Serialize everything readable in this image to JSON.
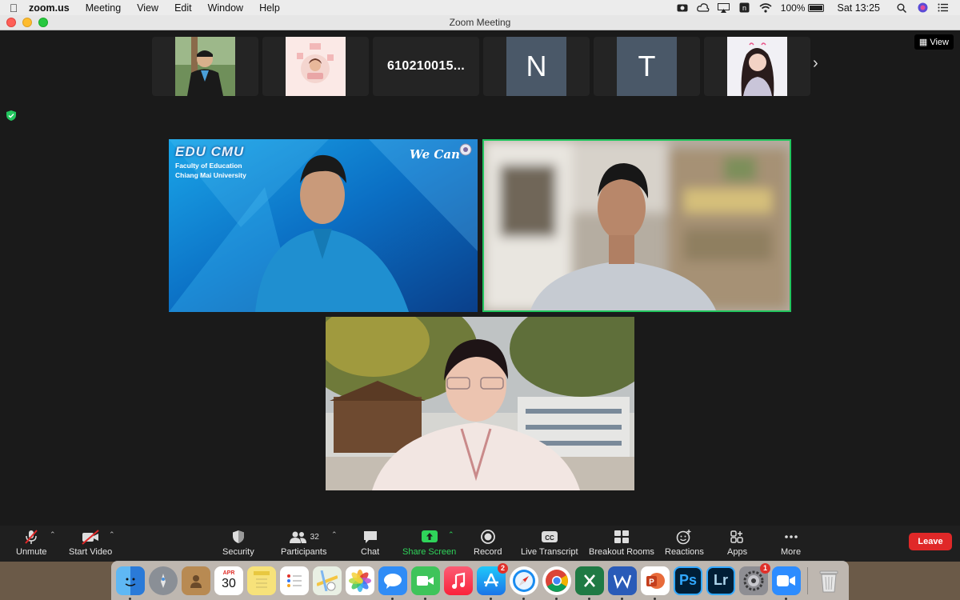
{
  "menubar": {
    "app_name": "zoom.us",
    "menus": [
      "Meeting",
      "View",
      "Edit",
      "Window",
      "Help"
    ],
    "battery": "100%",
    "clock": "Sat 13:25"
  },
  "window": {
    "title": "Zoom Meeting"
  },
  "strip": {
    "participant_name": "610210015...",
    "letter_n": "N",
    "letter_t": "T",
    "view_label": "View",
    "next_glyph": "›"
  },
  "tiles": {
    "logo_text": "EDU CMU",
    "faculty_line1": "Faculty of Education",
    "faculty_line2": "Chiang Mai University",
    "slogan": "We Can"
  },
  "toolbar": {
    "unmute": "Unmute",
    "start_video": "Start Video",
    "security": "Security",
    "participants": "Participants",
    "participants_count": "32",
    "chat": "Chat",
    "share_screen": "Share Screen",
    "record": "Record",
    "live_transcript": "Live Transcript",
    "breakout_rooms": "Breakout Rooms",
    "reactions": "Reactions",
    "apps": "Apps",
    "more": "More",
    "leave": "Leave"
  },
  "dock": {
    "calendar_month": "APR",
    "calendar_day": "30",
    "appstore_badge": "2",
    "settings_badge": "1",
    "ps_label": "Ps",
    "lr_label": "Lr"
  },
  "colors": {
    "accent_green": "#22c55e",
    "leave_red": "#e02828",
    "letter_tile": "#4a5868"
  }
}
